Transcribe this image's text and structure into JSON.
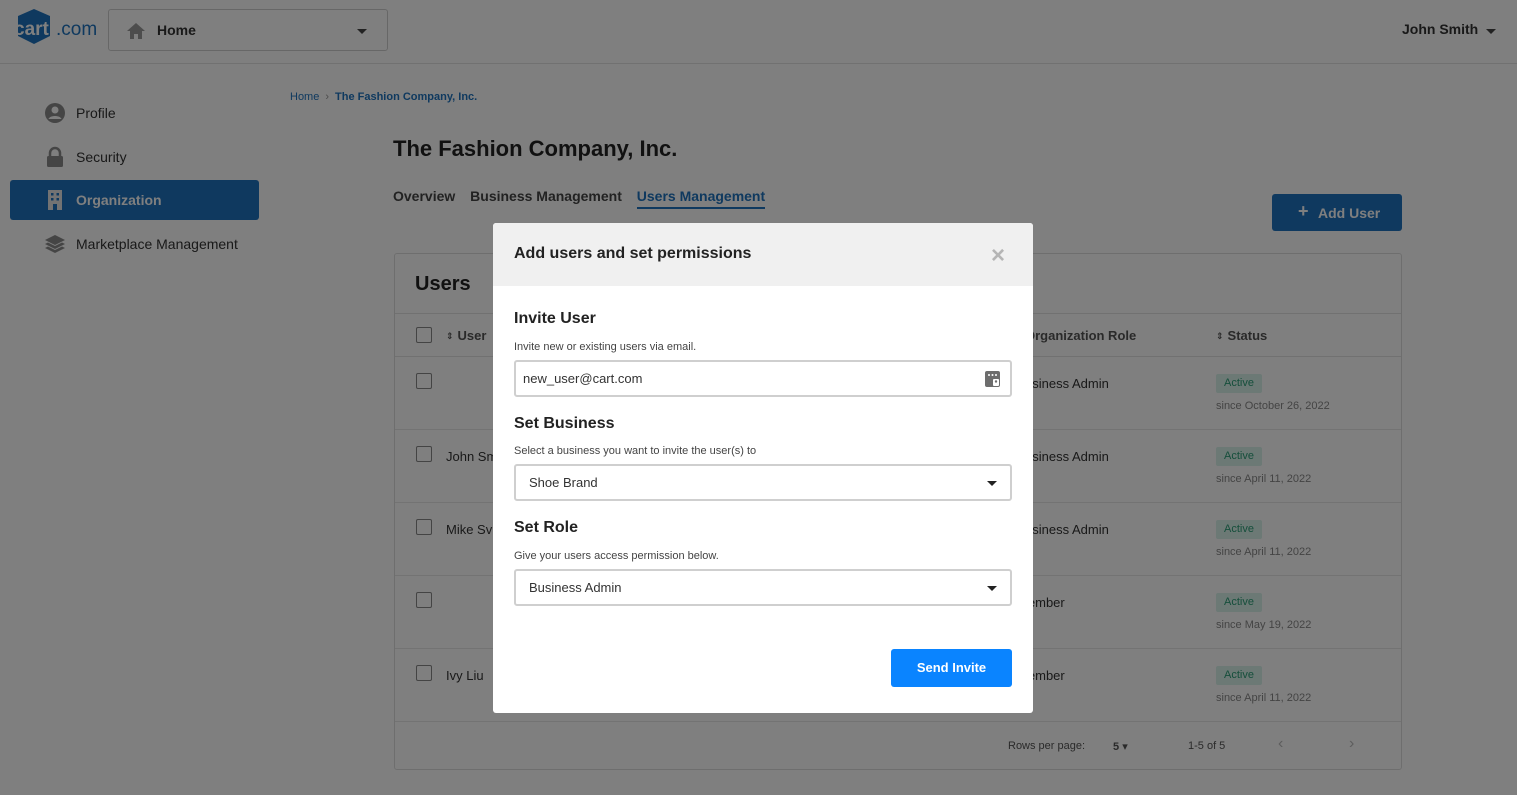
{
  "app": {
    "logo_text": "cart.com"
  },
  "header": {
    "home_select_label": "Home",
    "user_name": "John Smith"
  },
  "sidebar": {
    "items": [
      {
        "label": "Profile",
        "icon": "user-circle-icon"
      },
      {
        "label": "Security",
        "icon": "lock-icon"
      },
      {
        "label": "Organization",
        "icon": "building-icon",
        "active": true
      },
      {
        "label": "Marketplace Management",
        "icon": "layers-icon"
      }
    ]
  },
  "breadcrumb": {
    "home": "Home",
    "separator": "›",
    "current": "The Fashion Company, Inc."
  },
  "page": {
    "title": "The Fashion Company, Inc.",
    "tabs": [
      "Overview",
      "Business Management",
      "Users Management"
    ],
    "active_tab": "Users Management",
    "add_user_label": "Add User"
  },
  "users_table": {
    "title": "Users",
    "columns": {
      "user": "User",
      "org_role": "Organization Role",
      "status": "Status"
    },
    "rows": [
      {
        "name": "",
        "role": "usiness Admin",
        "status": "Active",
        "since": "since October 26, 2022"
      },
      {
        "name": "John Sm",
        "role": "usiness Admin",
        "status": "Active",
        "since": "since April 11, 2022"
      },
      {
        "name": "Mike Sv",
        "role": "usiness Admin",
        "status": "Active",
        "since": "since April 11, 2022"
      },
      {
        "name": "",
        "role": "lember",
        "status": "Active",
        "since": "since May 19, 2022"
      },
      {
        "name": "Ivy Liu",
        "role": "lember",
        "status": "Active",
        "since": "since April 11, 2022"
      }
    ],
    "footer": {
      "rows_per_page_label": "Rows per page:",
      "rows_per_page_value": "5",
      "range": "1-5 of 5"
    }
  },
  "modal": {
    "title": "Add users and set permissions",
    "invite": {
      "title": "Invite User",
      "description": "Invite new or existing users via email.",
      "value": "new_user@cart.com"
    },
    "business": {
      "title": "Set Business",
      "description": "Select a business you want to invite the user(s) to",
      "value": "Shoe Brand"
    },
    "role": {
      "title": "Set Role",
      "description": "Give your users access permission below.",
      "value": "Business Admin"
    },
    "send_label": "Send Invite"
  },
  "colors": {
    "accent": "#1e73be",
    "primary_button": "#0a84ff",
    "active_badge_bg": "#d9f3ea",
    "active_badge_text": "#2a9d76"
  }
}
